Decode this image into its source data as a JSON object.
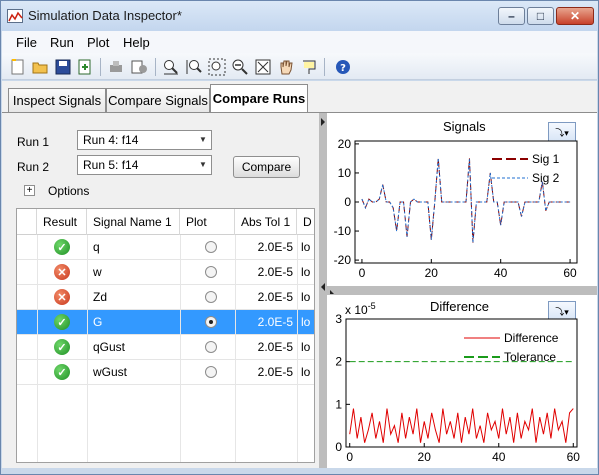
{
  "window": {
    "title": "Simulation Data Inspector*"
  },
  "menu": [
    "File",
    "Run",
    "Plot",
    "Help"
  ],
  "toolbar": {
    "icons": [
      "new-icon",
      "open-icon",
      "save-icon",
      "import-icon",
      "export-icon",
      "report-icon",
      "zoom-in-time-icon",
      "zoom-in-y-icon",
      "zoom-in-icon",
      "zoom-out-icon",
      "fit-to-view-icon",
      "pan-icon",
      "data-cursor-icon",
      "help-icon"
    ]
  },
  "tabs": [
    {
      "label": "Inspect Signals"
    },
    {
      "label": "Compare Signals"
    },
    {
      "label": "Compare Runs"
    }
  ],
  "runs": {
    "run1_label": "Run 1",
    "run1_value": "Run 4: f14",
    "run2_label": "Run 2",
    "run2_value": "Run 5: f14",
    "compare_button": "Compare",
    "options_label": "Options"
  },
  "table": {
    "headers": [
      "Result",
      "Signal Name 1",
      "Plot",
      "Abs Tol 1",
      "D"
    ],
    "rows": [
      {
        "result": "pass",
        "name": "q",
        "plot": false,
        "abs_tol": "2.0E-5",
        "extra": "lo"
      },
      {
        "result": "fail",
        "name": "w",
        "plot": false,
        "abs_tol": "2.0E-5",
        "extra": "lo"
      },
      {
        "result": "fail",
        "name": "Zd",
        "plot": false,
        "abs_tol": "2.0E-5",
        "extra": "lo"
      },
      {
        "result": "pass",
        "name": "G",
        "plot": true,
        "abs_tol": "2.0E-5",
        "extra": "lo"
      },
      {
        "result": "pass",
        "name": "qGust",
        "plot": false,
        "abs_tol": "2.0E-5",
        "extra": "lo"
      },
      {
        "result": "pass",
        "name": "wGust",
        "plot": false,
        "abs_tol": "2.0E-5",
        "extra": "lo"
      }
    ]
  },
  "chart_data": [
    {
      "type": "line",
      "title": "Signals",
      "xlim": [
        -2,
        62
      ],
      "ylim": [
        -21,
        21
      ],
      "xticks": [
        0,
        20,
        40,
        60
      ],
      "yticks": [
        -20,
        -10,
        0,
        10,
        20
      ],
      "legend": "top-right",
      "series": [
        {
          "name": "Sig 1",
          "color": "#8b0000",
          "style": "dashed",
          "x": [
            0,
            1,
            2,
            3,
            4,
            5,
            6,
            7,
            8,
            9,
            10,
            11,
            12,
            13,
            14,
            15,
            16,
            17,
            18,
            19,
            20,
            21,
            22,
            23,
            24,
            25,
            26,
            27,
            28,
            29,
            30,
            31,
            32,
            33,
            34,
            35,
            36,
            37,
            38,
            39,
            40,
            41,
            42,
            43,
            44,
            45,
            46,
            47,
            48,
            49,
            50,
            51,
            52,
            53,
            54,
            55,
            56,
            57,
            58,
            59,
            60
          ],
          "y": [
            1,
            -2,
            1,
            0,
            0,
            1,
            6,
            0,
            0,
            -2,
            -10,
            0,
            0,
            -12,
            0,
            1,
            0,
            0,
            0,
            0,
            -13,
            0,
            15,
            0,
            0,
            0,
            0,
            0,
            0,
            0,
            0,
            15,
            -14,
            0,
            0,
            0,
            0,
            10,
            0,
            0,
            -8,
            0,
            0,
            0,
            0,
            0,
            -5,
            0,
            0,
            0,
            0,
            0,
            7,
            -3,
            0,
            0,
            0,
            0,
            0,
            0,
            0
          ]
        },
        {
          "name": "Sig 2",
          "color": "#1f6fd0",
          "style": "dotted",
          "x": [
            0,
            1,
            2,
            3,
            4,
            5,
            6,
            7,
            8,
            9,
            10,
            11,
            12,
            13,
            14,
            15,
            16,
            17,
            18,
            19,
            20,
            21,
            22,
            23,
            24,
            25,
            26,
            27,
            28,
            29,
            30,
            31,
            32,
            33,
            34,
            35,
            36,
            37,
            38,
            39,
            40,
            41,
            42,
            43,
            44,
            45,
            46,
            47,
            48,
            49,
            50,
            51,
            52,
            53,
            54,
            55,
            56,
            57,
            58,
            59,
            60
          ],
          "y": [
            1,
            -2,
            1,
            0,
            0,
            1,
            6,
            0,
            0,
            -2,
            -10,
            0,
            0,
            -12,
            0,
            1,
            0,
            0,
            0,
            0,
            -13,
            0,
            15,
            0,
            0,
            0,
            0,
            0,
            0,
            0,
            0,
            15,
            -14,
            0,
            0,
            0,
            0,
            10,
            0,
            0,
            -8,
            0,
            0,
            0,
            0,
            0,
            -5,
            0,
            0,
            0,
            0,
            0,
            7,
            -3,
            0,
            0,
            0,
            0,
            0,
            0,
            0
          ]
        }
      ]
    },
    {
      "type": "line",
      "title": "Difference",
      "y_exponent_label": "x 10",
      "y_exponent_power": "-5",
      "xlim": [
        -1,
        61
      ],
      "ylim": [
        0,
        3
      ],
      "xticks": [
        0,
        20,
        40,
        60
      ],
      "yticks": [
        0,
        1,
        2,
        3
      ],
      "legend": "top-right",
      "series": [
        {
          "name": "Difference",
          "color": "#e00000",
          "style": "solid",
          "x": [
            0,
            1,
            2,
            3,
            4,
            5,
            6,
            7,
            8,
            9,
            10,
            11,
            12,
            13,
            14,
            15,
            16,
            17,
            18,
            19,
            20,
            21,
            22,
            23,
            24,
            25,
            26,
            27,
            28,
            29,
            30,
            31,
            32,
            33,
            34,
            35,
            36,
            37,
            38,
            39,
            40,
            41,
            42,
            43,
            44,
            45,
            46,
            47,
            48,
            49,
            50,
            51,
            52,
            53,
            54,
            55,
            56,
            57,
            58,
            59,
            60
          ],
          "y": [
            0.3,
            0.9,
            0.2,
            0.7,
            0.1,
            0.4,
            0.8,
            0.2,
            0.6,
            0.1,
            0.9,
            0.3,
            0.5,
            0.1,
            0.8,
            0.2,
            0.7,
            0.3,
            0.9,
            0.1,
            0.6,
            0.2,
            0.8,
            0.4,
            0.1,
            0.9,
            0.3,
            0.6,
            0.2,
            0.8,
            0.1,
            0.7,
            0.3,
            0.9,
            0.2,
            0.5,
            0.1,
            0.8,
            0.4,
            0.6,
            0.2,
            0.9,
            0.3,
            0.7,
            0.1,
            0.8,
            0.2,
            0.6,
            0.4,
            0.9,
            0.1,
            0.7,
            0.3,
            0.8,
            0.2,
            0.9,
            0.4,
            0.6,
            0.1,
            0.8,
            0.9
          ]
        },
        {
          "name": "Tolerance",
          "color": "#1b9b1b",
          "style": "dashed",
          "x": [
            0,
            60
          ],
          "y": [
            2,
            2
          ]
        }
      ]
    }
  ]
}
